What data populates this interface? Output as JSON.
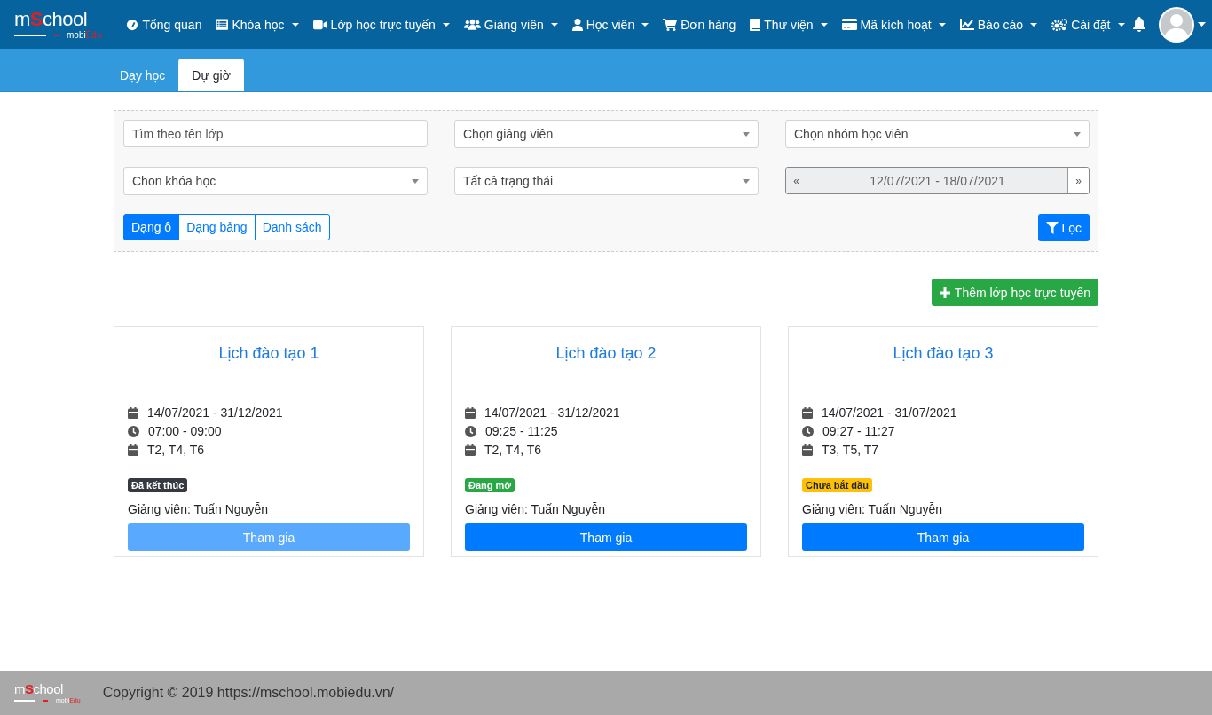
{
  "navbar": {
    "logo": {
      "wordmark": "m**S**chool",
      "tagline": "mobi**Edu**"
    },
    "items": [
      {
        "label": "Tổng quan",
        "dropdown": false
      },
      {
        "label": "Khóa học",
        "dropdown": true
      },
      {
        "label": "Lớp học trực tuyến",
        "dropdown": true
      },
      {
        "label": "Giảng viên",
        "dropdown": true
      },
      {
        "label": "Học viên",
        "dropdown": true
      },
      {
        "label": "Đơn hàng",
        "dropdown": false
      },
      {
        "label": "Thư viện",
        "dropdown": true
      },
      {
        "label": "Mã kích hoạt",
        "dropdown": true
      },
      {
        "label": "Báo cáo",
        "dropdown": true
      },
      {
        "label": "Cài đặt",
        "dropdown": true
      }
    ]
  },
  "tabs": [
    {
      "label": "Dạy học",
      "selected": false
    },
    {
      "label": "Dự giờ",
      "selected": true
    }
  ],
  "filters": {
    "search": {
      "placeholder": "Tìm theo tên lớp"
    },
    "selects": [
      {
        "value": "Chọn giảng viên"
      },
      {
        "value": "Chọn nhóm học viên"
      },
      {
        "value": "Chon khóa học"
      },
      {
        "value": "Tất cả trạng thái"
      }
    ],
    "date_range": {
      "prev": "«",
      "value": "12/07/2021 - 18/07/2021",
      "next": "»"
    },
    "views": [
      {
        "label": "Dạng ô",
        "selected": true
      },
      {
        "label": "Dạng bảng",
        "selected": false
      },
      {
        "label": "Danh sách",
        "selected": false
      }
    ],
    "filter_button": "Lọc"
  },
  "add_button": "Thêm lớp học trực tuyến",
  "cards": [
    {
      "title": "Lịch đào tạo 1",
      "date_range": "14/07/2021 - 31/12/2021",
      "time": "07:00 - 09:00",
      "days": "T2, T4, T6",
      "status": {
        "label": "Đã kết thúc",
        "color": "#343a40"
      },
      "teacher": "Giảng viên: Tuấn Nguyễn",
      "join": {
        "label": "Tham gia",
        "disabled": true
      }
    },
    {
      "title": "Lịch đào tạo 2",
      "date_range": "14/07/2021 - 31/12/2021",
      "time": "09:25 - 11:25",
      "days": "T2, T4, T6",
      "status": {
        "label": "Đang mở",
        "color": "#28a745"
      },
      "teacher": "Giảng viên: Tuấn Nguyễn",
      "join": {
        "label": "Tham gia",
        "disabled": false
      }
    },
    {
      "title": "Lịch đào tạo 3",
      "date_range": "14/07/2021 - 31/07/2021",
      "time": "09:27 - 11:27",
      "days": "T3, T5, T7",
      "status": {
        "label": "Chưa bắt đầu",
        "color": "#ffc107"
      },
      "teacher": "Giảng viên: Tuấn Nguyễn",
      "join": {
        "label": "Tham gia",
        "disabled": false
      }
    }
  ],
  "footer": {
    "logo": {
      "wordmark": "m**S**chool",
      "tagline": "mobi**Edu**"
    },
    "copyright": "Copyright © 2019 https://mschool.mobiedu.vn/"
  }
}
